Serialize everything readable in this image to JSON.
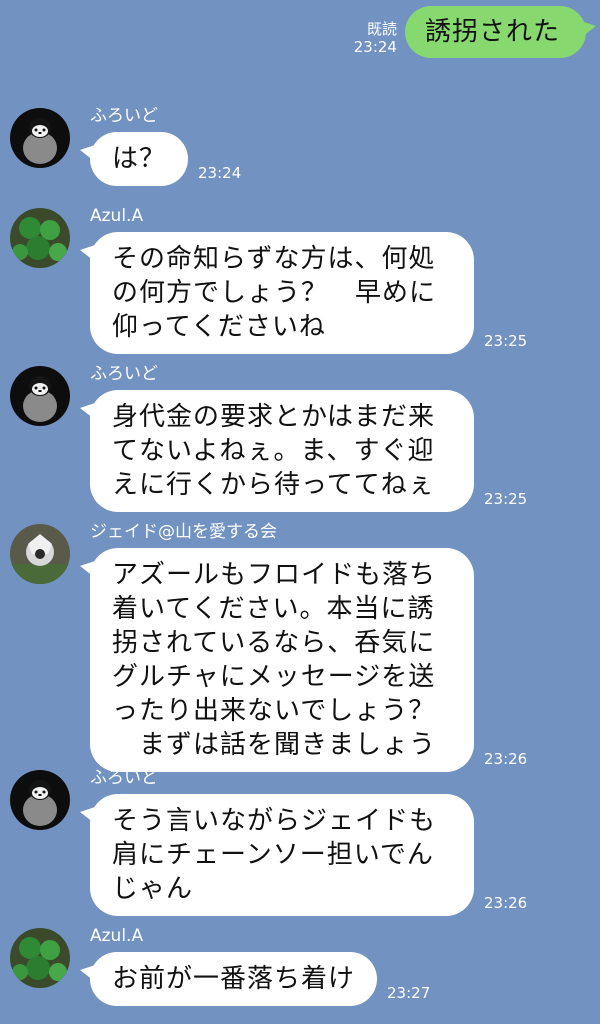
{
  "outgoing": {
    "read_label": "既読",
    "time": "23:24",
    "text": "誘拐された"
  },
  "messages": [
    {
      "sender": "ふろいど",
      "avatar": "penguin-avatar",
      "text": "は？",
      "time": "23:24"
    },
    {
      "sender": "Azul.A",
      "avatar": "clover-avatar",
      "text": "その命知らずな方は、何処\nの何方でしょう？　早めに\n仰ってくださいね",
      "time": "23:25"
    },
    {
      "sender": "ふろいど",
      "avatar": "penguin-avatar",
      "text": "身代金の要求とかはまだ来\nてないよねぇ。ま、すぐ迎\nえに行くから待っててねぇ",
      "time": "23:25"
    },
    {
      "sender": "ジェイド@山を愛する会",
      "avatar": "mushroom-avatar",
      "text": "アズールもフロイドも落ち\n着いてください。本当に誘\n拐されているなら、呑気に\nグルチャにメッセージを送\nったり出来ないでしょう？\n　まずは話を聞きましょう",
      "time": "23:26"
    },
    {
      "sender": "ふろいど",
      "avatar": "penguin-avatar",
      "text": "そう言いながらジェイドも\n肩にチェーンソー担いでん\nじゃん",
      "time": "23:26"
    },
    {
      "sender": "Azul.A",
      "avatar": "clover-avatar",
      "text": "お前が一番落ち着け",
      "time": "23:27"
    }
  ]
}
